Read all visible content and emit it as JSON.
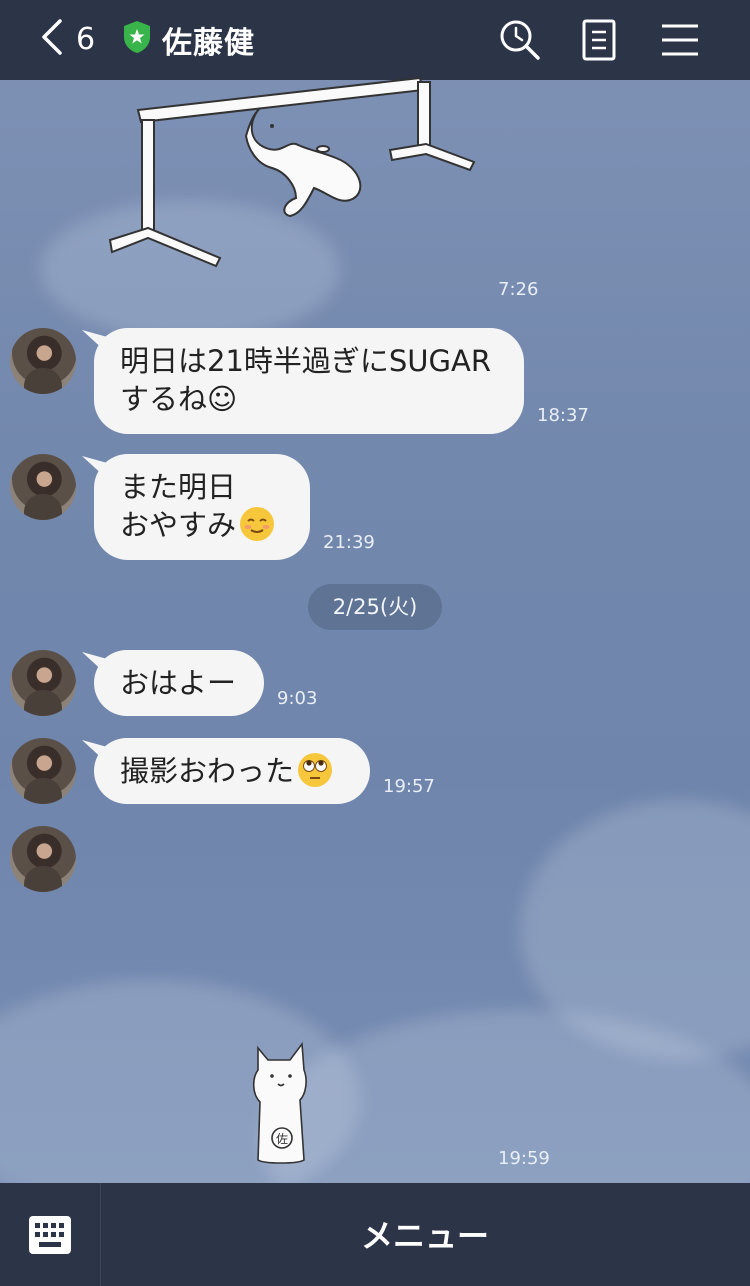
{
  "header": {
    "back_count": "6",
    "title": "佐藤健"
  },
  "messages": [
    {
      "sticker": "cat-gym-bar",
      "time": "7:26"
    },
    {
      "text_line1": "明日は21時半過ぎにSUGAR",
      "text_line2": "するね☺",
      "time": "18:37"
    },
    {
      "text_line1": "また明日",
      "text_line2": "おやすみ",
      "emoji": "relieved-face",
      "time": "21:39"
    },
    {
      "text": "おはよー",
      "time": "9:03"
    },
    {
      "text": "撮影おわった",
      "emoji": "face-with-rolling-eyes",
      "time": "19:57"
    },
    {
      "sticker": "cat-standing-sato",
      "sticker_text": "佐",
      "time": "19:59"
    }
  ],
  "date_separator": "2/25(火)",
  "bottom": {
    "menu_label": "メニュー"
  },
  "colors": {
    "header_bg": "#2c3448",
    "bubble_bg": "#f5f5f6",
    "shield_green": "#39b44a"
  }
}
